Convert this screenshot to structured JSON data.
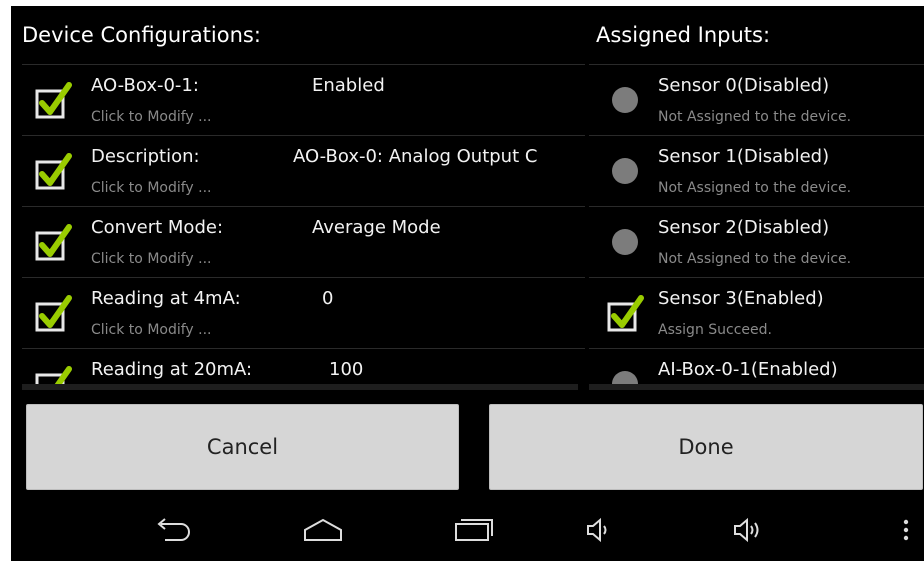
{
  "header": {
    "left_title": "Device Configurations:",
    "right_title": "Assigned Inputs:"
  },
  "configs": [
    {
      "label": "AO-Box-0-1:",
      "value": "Enabled",
      "sub": "Click to Modify ...",
      "checked": true
    },
    {
      "label": "Description:",
      "value": "AO-Box-0: Analog Output C",
      "sub": "Click to Modify ...",
      "checked": true
    },
    {
      "label": "Convert Mode:",
      "value": "Average Mode",
      "sub": "Click to Modify ...",
      "checked": true
    },
    {
      "label": "Reading at 4mA:",
      "value": "0",
      "sub": "Click to Modify ...",
      "checked": true
    },
    {
      "label": "Reading at 20mA:",
      "value": "100",
      "sub": "",
      "checked": true
    }
  ],
  "inputs": [
    {
      "name": "Sensor 0(Disabled)",
      "status": "Not Assigned to the device.",
      "state": "dot"
    },
    {
      "name": "Sensor 1(Disabled)",
      "status": "Not Assigned to the device.",
      "state": "dot"
    },
    {
      "name": "Sensor 2(Disabled)",
      "status": "Not Assigned to the device.",
      "state": "dot"
    },
    {
      "name": "Sensor 3(Enabled)",
      "status": "Assign Succeed.",
      "state": "checked"
    },
    {
      "name": "AI-Box-0-1(Enabled)",
      "status": "",
      "state": "dot"
    }
  ],
  "buttons": {
    "cancel": "Cancel",
    "done": "Done"
  },
  "navbar": {
    "icons": [
      "back-icon",
      "home-icon",
      "recent-apps-icon",
      "volume-down-icon",
      "volume-up-icon",
      "menu-icon"
    ]
  },
  "colors": {
    "background": "#000000",
    "checkbox_check": "#99cc00",
    "button": "#d6d6d6",
    "secondary_text": "#8a8a8a"
  }
}
